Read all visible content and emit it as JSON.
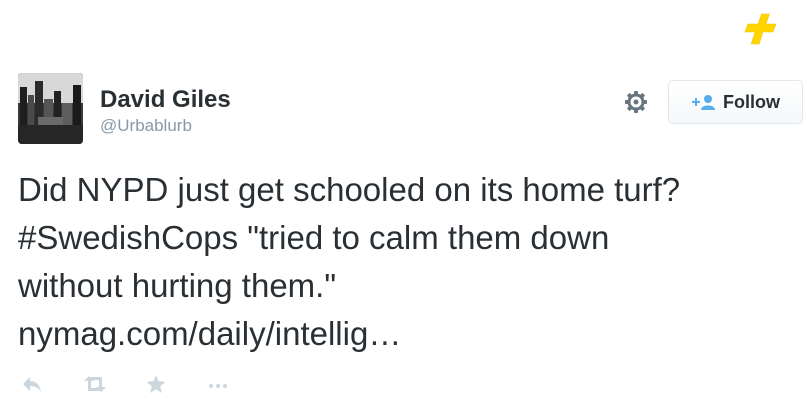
{
  "tweet": {
    "author": {
      "name": "David Giles",
      "handle": "@Urbablurb"
    },
    "follow_label": "Follow",
    "text": {
      "line1": "Did NYPD just get schooled on its home turf?",
      "hashtag": "#SwedishCops",
      "line2_rest": " \"tried to calm them down",
      "line3": "without hurting them.\"",
      "link": "nymag.com/daily/intellig…"
    },
    "actions": [
      "reply-icon",
      "retweet-icon",
      "favorite-icon",
      "more-icon"
    ]
  },
  "colors": {
    "text": "#292f33",
    "handle": "#8899a6",
    "accent": "#55acee",
    "action_icons": "#ccd6dd",
    "watermark": "#ffd400"
  }
}
